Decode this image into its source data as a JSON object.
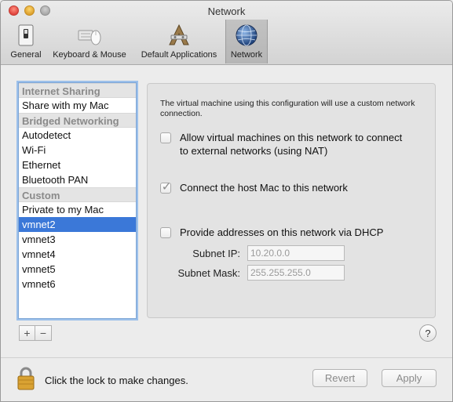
{
  "window": {
    "title": "Network"
  },
  "toolbar": {
    "items": [
      {
        "label": "General",
        "icon": "switch-icon"
      },
      {
        "label": "Keyboard & Mouse",
        "icon": "keyboard-mouse-icon"
      },
      {
        "label": "Default Applications",
        "icon": "applications-icon"
      },
      {
        "label": "Network",
        "icon": "globe-icon",
        "selected": true
      }
    ]
  },
  "network_list": {
    "groups": [
      {
        "header": "Internet Sharing",
        "items": [
          "Share with my Mac"
        ]
      },
      {
        "header": "Bridged Networking",
        "items": [
          "Autodetect",
          "Wi-Fi",
          "Ethernet",
          "Bluetooth PAN"
        ]
      },
      {
        "header": "Custom",
        "items": [
          "Private to my Mac",
          "vmnet2",
          "vmnet3",
          "vmnet4",
          "vmnet5",
          "vmnet6"
        ]
      }
    ],
    "selected": "vmnet2",
    "add_label": "+",
    "remove_label": "−"
  },
  "panel": {
    "description": "The virtual machine using this configuration will use a custom network connection.",
    "nat_option": {
      "label": "Allow virtual machines on this network to connect to external networks (using NAT)",
      "checked": false
    },
    "host_option": {
      "label": "Connect the host Mac to this network",
      "checked": true
    },
    "dhcp_option": {
      "label": "Provide addresses on this network via DHCP",
      "checked": false
    },
    "subnet_ip": {
      "label": "Subnet IP:",
      "value": "10.20.0.0"
    },
    "subnet_mask": {
      "label": "Subnet Mask:",
      "value": "255.255.255.0"
    },
    "check_glyph": "✓"
  },
  "help": {
    "label": "?"
  },
  "footer": {
    "lock_text": "Click the lock to make changes.",
    "revert_label": "Revert",
    "apply_label": "Apply"
  },
  "colors": {
    "selection": "#3b78d8",
    "list_focus": "#9cc0ea"
  }
}
